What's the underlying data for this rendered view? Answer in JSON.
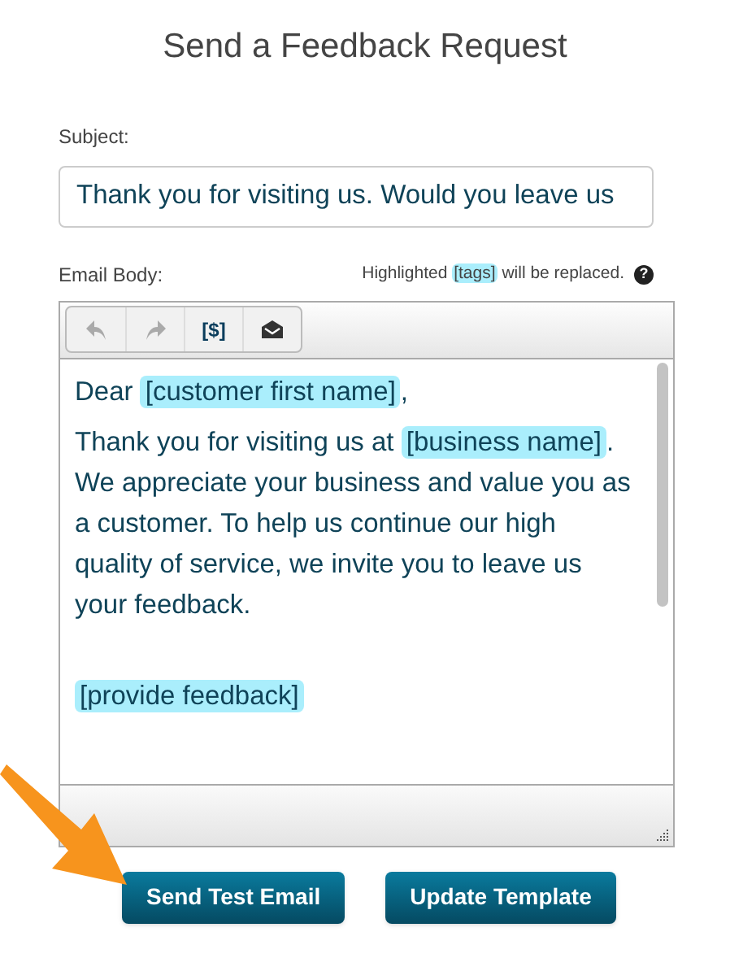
{
  "title": "Send a Feedback Request",
  "subject": {
    "label": "Subject:",
    "value": "Thank you for visiting us. Would you leave us"
  },
  "body": {
    "label": "Email Body:",
    "hint": [
      {
        "kind": "text",
        "text": "Highlighted"
      },
      {
        "kind": "tag",
        "text": "[tags]"
      },
      {
        "kind": "text",
        "text": "will be replaced."
      }
    ],
    "help": "?",
    "toolbar": [
      {
        "kind": "undo",
        "disabled": true
      },
      {
        "kind": "redo",
        "disabled": true
      },
      {
        "kind": "tags",
        "label": "[$]",
        "disabled": false
      },
      {
        "kind": "preview",
        "disabled": false
      }
    ],
    "paragraphs": [
      [
        {
          "kind": "text",
          "text": "Dear"
        },
        {
          "kind": "tag",
          "text": "[customer first name]"
        },
        {
          "kind": "text",
          "text": ","
        }
      ],
      [
        {
          "kind": "text",
          "text": "Thank you for visiting us at"
        },
        {
          "kind": "tag",
          "text": "[business name]"
        },
        {
          "kind": "text",
          "text": ". We appreciate your business and value you as a customer. To help us continue our high quality of service, we invite you to leave us your feedback."
        }
      ],
      [
        {
          "kind": "tag",
          "text": "[provide feedback]"
        }
      ]
    ]
  },
  "buttons": [
    {
      "label": "Send Test Email"
    },
    {
      "label": "Update Template"
    }
  ]
}
